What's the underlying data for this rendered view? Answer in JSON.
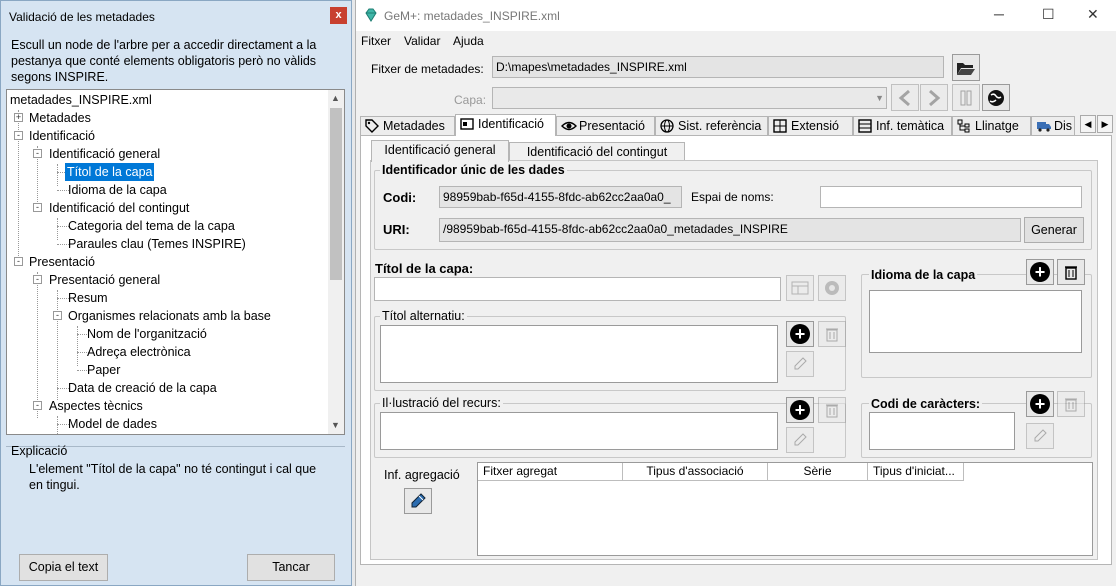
{
  "validation": {
    "title": "Validació de les metadades",
    "close": "x",
    "description": "Escull un node de l'arbre per a accedir directament a la pestanya que conté elements obligatoris però no vàlids segons INSPIRE.",
    "tree": {
      "root": "metadades_INSPIRE.xml",
      "nodes": [
        {
          "label": "Metadades",
          "expand": "+"
        },
        {
          "label": "Identificació",
          "expand": "-"
        },
        {
          "label": "Identificació general",
          "expand": "-"
        },
        {
          "label": "Títol de la capa",
          "selected": true
        },
        {
          "label": "Idioma de la capa"
        },
        {
          "label": "Identificació del contingut",
          "expand": "-"
        },
        {
          "label": "Categoria del tema de la capa"
        },
        {
          "label": "Paraules clau (Temes INSPIRE)"
        },
        {
          "label": "Presentació",
          "expand": "-"
        },
        {
          "label": "Presentació general",
          "expand": "-"
        },
        {
          "label": "Resum"
        },
        {
          "label": "Organismes relacionats amb la base",
          "expand": "-"
        },
        {
          "label": "Nom de l'organització"
        },
        {
          "label": "Adreça electrònica"
        },
        {
          "label": "Paper"
        },
        {
          "label": "Data de creació de la capa"
        },
        {
          "label": "Aspectes tècnics",
          "expand": "-"
        },
        {
          "label": "Model de dades"
        }
      ]
    },
    "explanation": {
      "label": "Explicació",
      "text": "L'element \"Títol de la capa\" no té contingut i cal que en tingui."
    },
    "copy_button": "Copia el text",
    "close_button": "Tancar"
  },
  "gem": {
    "title": "GeM+: metadades_INSPIRE.xml",
    "menu": [
      "Fitxer",
      "Validar",
      "Ajuda"
    ],
    "metadata_file_label": "Fitxer de metadades:",
    "metadata_file_value": "D:\\mapes\\metadades_INSPIRE.xml",
    "layer_label": "Capa:",
    "tabs": [
      "Metadades",
      "Identificació",
      "Presentació",
      "Sist. referència",
      "Extensió",
      "Inf. temàtica",
      "Llinatge",
      "Dis"
    ],
    "active_tab": "Identificació",
    "subtabs": [
      "Identificació general",
      "Identificació del contingut"
    ],
    "unique_id": {
      "title": "Identificador únic de les dades",
      "code_label": "Codi:",
      "code_value": "98959bab-f65d-4155-8fdc-ab62cc2aa0a0_",
      "namespace_label": "Espai de noms:",
      "namespace_value": "",
      "uri_label": "URI:",
      "uri_value": "/98959bab-f65d-4155-8fdc-ab62cc2aa0a0_metadades_INSPIRE",
      "generate_button": "Generar"
    },
    "layer_title_label": "Títol de la capa:",
    "layer_title_value": "",
    "alt_title_label": "Títol alternatiu:",
    "illustration_label": "Il·lustració del recurs:",
    "language_label": "Idioma de la capa",
    "charset_label": "Codi de caràcters:",
    "aggregation_label": "Inf. agregació",
    "aggregation_columns": [
      "Fitxer agregat",
      "Tipus d'associació",
      "Sèrie",
      "Tipus d'iniciat..."
    ]
  }
}
